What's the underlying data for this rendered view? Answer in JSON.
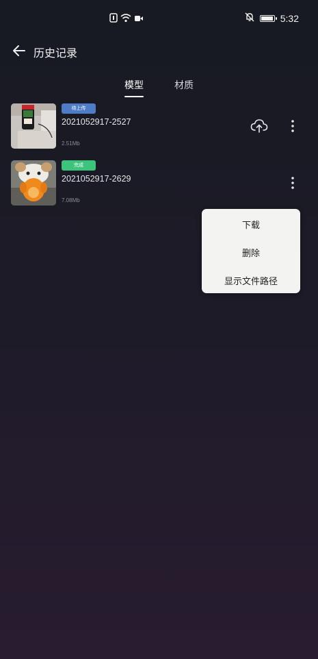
{
  "status_bar": {
    "time": "5:32",
    "icons": [
      "nfc-icon",
      "wifi-icon",
      "video-icon",
      "mute-bell-icon",
      "battery-icon"
    ],
    "battery_level": 1.0
  },
  "header": {
    "title": "历史记录",
    "back_icon": "back-arrow-icon"
  },
  "tabs": [
    {
      "label": "模型",
      "active": true
    },
    {
      "label": "材质",
      "active": false
    }
  ],
  "items": [
    {
      "name": "2021052917-2527",
      "status": "待上传",
      "status_color": "#4f7cc6",
      "size": "2.51Mb",
      "actions": [
        "upload-icon",
        "more-icon"
      ]
    },
    {
      "name": "2021052917-2629",
      "status": "完成",
      "status_color": "#3cc37c",
      "size": "7.08Mb",
      "actions": [
        "more-icon"
      ]
    }
  ],
  "context_menu": {
    "items": [
      "下载",
      "删除",
      "显示文件路径"
    ]
  },
  "colors": {
    "background_top": "#171a22",
    "background_bottom": "#281c30",
    "menu_background": "#f3f3f1"
  }
}
